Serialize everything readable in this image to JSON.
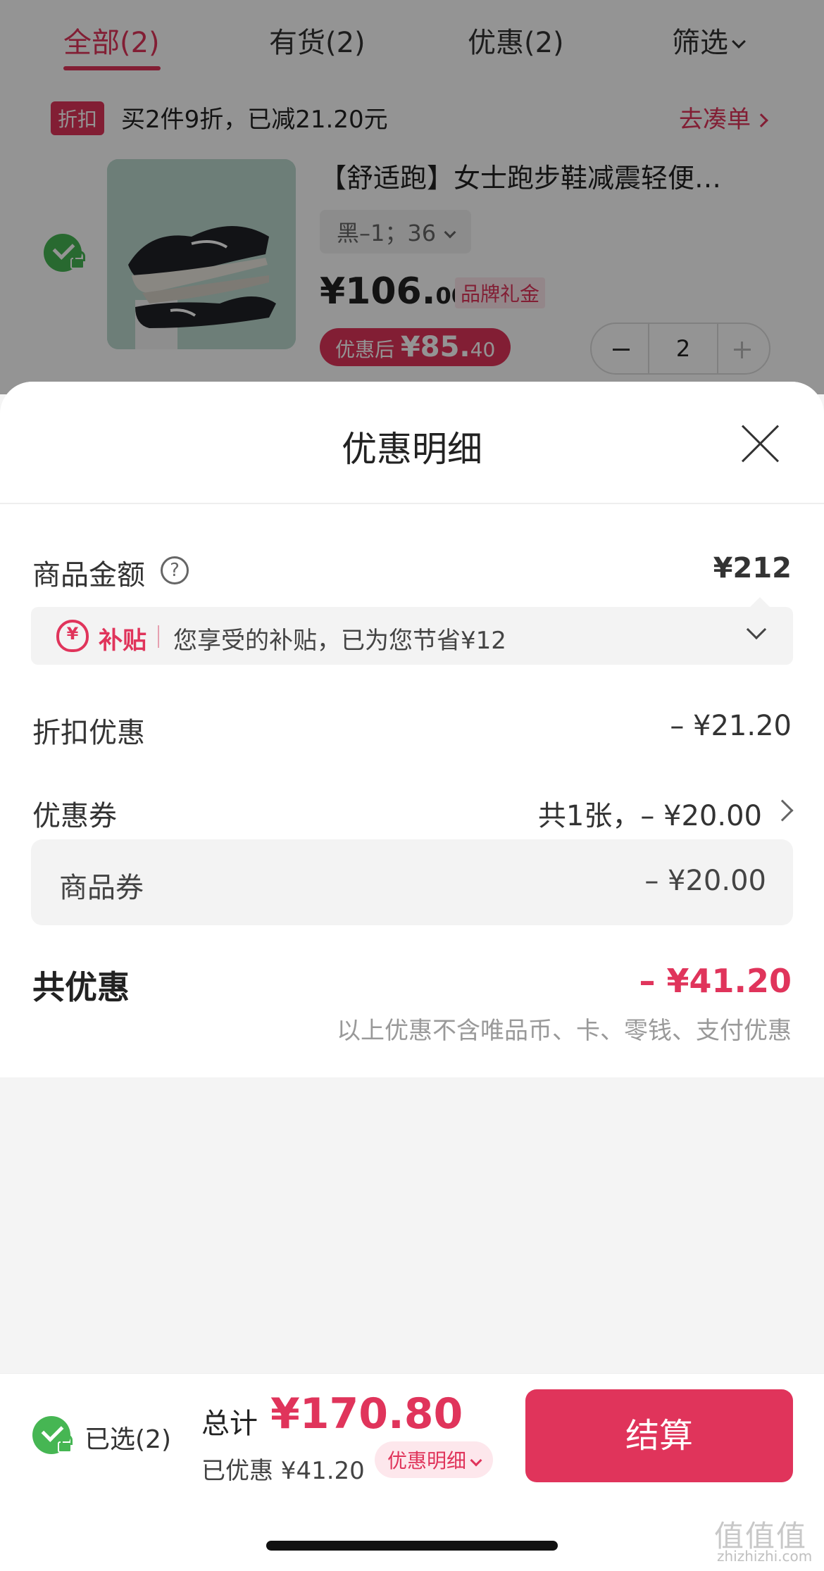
{
  "tabs": [
    {
      "label": "全部(2)",
      "active": true
    },
    {
      "label": "有货(2)"
    },
    {
      "label": "优惠(2)"
    },
    {
      "label": "筛选"
    }
  ],
  "promo": {
    "tag": "折扣",
    "text": "买2件9折，已减21.20元",
    "link": "去凑单"
  },
  "product": {
    "title": "【舒适跑】女士跑步鞋减震轻便…",
    "sku": "黑–1；36",
    "price_int": "¥106.",
    "price_cents": "00",
    "brand_tag": "品牌礼金",
    "after_label": "优惠后",
    "after_int": "¥85.",
    "after_cents": "40",
    "quantity": "2"
  },
  "sheet": {
    "title": "优惠明细",
    "goods_amount_label": "商品金额",
    "help_icon": "?",
    "goods_amount_value": "¥212",
    "subsidy": {
      "label": "补贴",
      "text": "您享受的补贴，已为您节省¥12"
    },
    "discount_label": "折扣优惠",
    "discount_value": "– ¥21.20",
    "coupon_label": "优惠券",
    "coupon_value": "共1张，– ¥20.00",
    "coupon_item": {
      "name": "商品券",
      "amount": "– ¥20.00"
    },
    "total_label": "共优惠",
    "total_value": "– ¥41.20",
    "note": "以上优惠不含唯品币、卡、零钱、支付优惠"
  },
  "bottom": {
    "selected": "已选(2)",
    "sum_label": "总计",
    "sum_value": "¥170.80",
    "saved": "已优惠 ¥41.20",
    "detail_link": "优惠明细",
    "checkout": "结算"
  },
  "watermark": {
    "text": "值值值",
    "url": "zhizhizhi.com"
  },
  "colors": {
    "accent": "#e0345b",
    "check": "#46b653",
    "background": "#f4f4f4"
  }
}
